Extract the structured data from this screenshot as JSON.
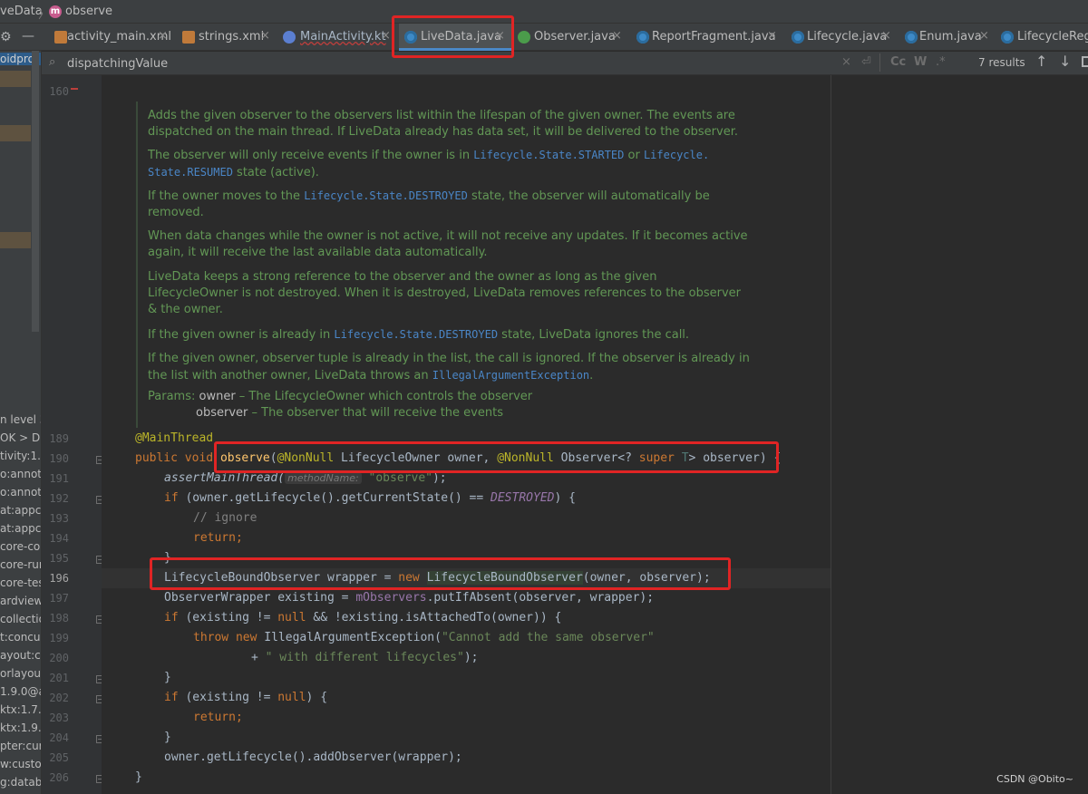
{
  "breadcrumb": {
    "class_label": "veData",
    "method_icon": "m",
    "method_label": "observe"
  },
  "tabs": [
    {
      "label": "activity_main.xml",
      "icon": "xml-file-icon",
      "close": "×"
    },
    {
      "label": "strings.xml",
      "icon": "xml-file-icon",
      "close": "×"
    },
    {
      "label": "MainActivity.kt",
      "icon": "kotlin-class-icon",
      "close": "×"
    },
    {
      "label": "LiveData.java",
      "icon": "java-class-icon",
      "close": "×"
    },
    {
      "label": "Observer.java",
      "icon": "java-interface-icon",
      "close": "×"
    },
    {
      "label": "ReportFragment.java",
      "icon": "java-class-icon",
      "close": "×"
    },
    {
      "label": "Lifecycle.java",
      "icon": "java-class-icon",
      "close": "×"
    },
    {
      "label": "Enum.java",
      "icon": "java-class-icon",
      "close": "×"
    },
    {
      "label": "LifecycleRegis",
      "icon": "java-class-icon",
      "close": ""
    }
  ],
  "search": {
    "value": "dispatchingValue",
    "results": "7 results",
    "cc": "Cc",
    "w": "W",
    "regex": ".*"
  },
  "left_panel": {
    "top_label": "oidproj",
    "items": [
      "n level 3",
      "OK >  D:\\",
      "tivity:1.6.",
      "o:annota",
      "o:annota",
      "at:appco",
      "at:appco",
      "core-cor",
      "core-run",
      "core-tes",
      "ardview",
      "collection",
      "t:concur",
      "ayout:co",
      "orlayout",
      "1.9.0@a",
      "ktx:1.7.0",
      "ktx:1.9.0",
      "pter:cur",
      "w:custor",
      "g:datab"
    ]
  },
  "gutter": {
    "top_line": "160",
    "lines": [
      "189",
      "190",
      "191",
      "192",
      "193",
      "194",
      "195",
      "196",
      "197",
      "198",
      "199",
      "200",
      "201",
      "202",
      "203",
      "204",
      "205",
      "206"
    ]
  },
  "doc": {
    "p1": [
      "Adds the given observer to the observers list within the lifespan of the given owner. The events are",
      "dispatched on the main thread. If LiveData already has data set, it will be delivered to the observer."
    ],
    "p2": {
      "a": "The observer will only receive events if the owner is in ",
      "b": "Lifecycle.State.STARTED",
      "c": " or ",
      "d": "Lifecycle.",
      "e": "State.RESUMED",
      "f": " state (active)."
    },
    "p3": {
      "a": "If the owner moves to the ",
      "b": "Lifecycle.State.DESTROYED",
      "c": " state, the observer will automatically be",
      "d": "removed."
    },
    "p4": [
      "When data changes while the owner is not active, it will not receive any updates. If it becomes active",
      "again, it will receive the last available data automatically."
    ],
    "p5": [
      "LiveData keeps a strong reference to the observer and the owner as long as the given",
      "LifecycleOwner is not destroyed. When it is destroyed, LiveData removes references to the observer",
      "& the owner."
    ],
    "p6": {
      "a": "If the given owner is already in ",
      "b": "Lifecycle.State.DESTROYED",
      "c": " state, LiveData ignores the call."
    },
    "p7": {
      "a": "If the given owner, observer tuple is already in the list, the call is ignored. If the observer is already in",
      "b": "the list with another owner, LiveData throws an ",
      "c": "IllegalArgumentException",
      "d": "."
    },
    "params": {
      "label": "Params:",
      "owner_name": "owner",
      "owner_desc": " – The LifecycleOwner which controls the observer",
      "observer_name": "observer",
      "observer_desc": " – The observer that will receive the events"
    }
  },
  "code": {
    "l189": {
      "ann": "@MainThread"
    },
    "l190": {
      "kw1": "public ",
      "kw2": "void ",
      "fn": "observe",
      "p1": "(",
      "ann1": "@NonNull",
      "t1": " LifecycleOwner owner, ",
      "ann2": "@NonNull",
      "t2": " Observer<? ",
      "kw3": "super ",
      "gen": "T",
      "t3": "> observer) {"
    },
    "l191": {
      "call": "assertMainThread(",
      "hint": "methodName:",
      "str": "\"observe\"",
      "end": ");"
    },
    "l192": {
      "kw": "if ",
      "a": "(owner.getLifecycle().getCurrentState() == ",
      "const": "DESTROYED",
      "b": ") {"
    },
    "l193": {
      "cmt": "// ignore"
    },
    "l194": {
      "kw": "return",
      "end": ";"
    },
    "l195": {
      "text": "}"
    },
    "l196": {
      "a": "LifecycleBoundObserver wrapper = ",
      "kw": "new ",
      "cls": "LifecycleBoundObserver",
      "b": "(owner, observer);"
    },
    "l197": {
      "a": "ObserverWrapper existing = ",
      "field": "mObservers",
      "b": ".putIfAbsent(observer, wrapper);"
    },
    "l198": {
      "kw": "if ",
      "a": "(existing != ",
      "kw2": "null",
      "b": " && !existing.isAttachedTo(owner)) {"
    },
    "l199": {
      "kw": "throw new ",
      "a": "IllegalArgumentException(",
      "str": "\"Cannot add the same observer\""
    },
    "l200": {
      "a": "+ ",
      "str": "\" with different lifecycles\"",
      "b": ");"
    },
    "l201": {
      "text": "}"
    },
    "l202": {
      "kw": "if ",
      "a": "(existing != ",
      "kw2": "null",
      "b": ") {"
    },
    "l203": {
      "kw": "return",
      "end": ";"
    },
    "l204": {
      "text": "}"
    },
    "l205": {
      "a": "owner.getLifecycle().addObserver(wrapper);"
    },
    "l206": {
      "text": "}"
    }
  },
  "watermark": "CSDN @Obito~",
  "colors": {
    "highlight_box": "#e02424",
    "doc_text": "#629755",
    "keyword": "#cc7832",
    "annotation": "#bbb529",
    "function": "#ffc66d"
  }
}
